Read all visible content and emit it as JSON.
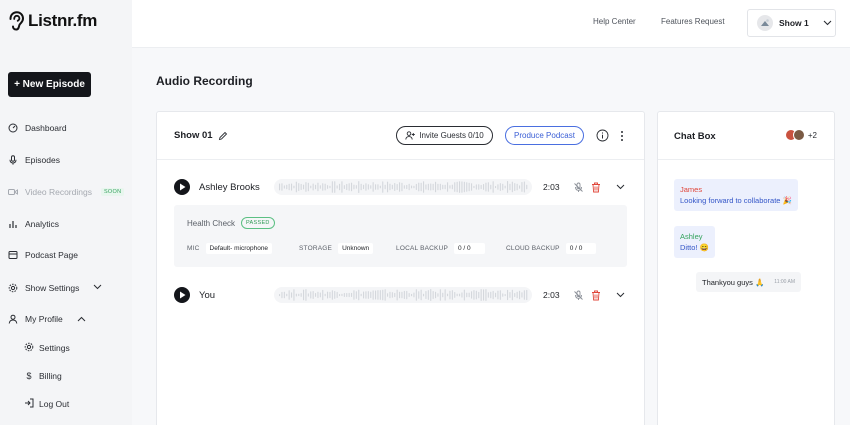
{
  "app": {
    "brand": "Listnr.fm",
    "new_episode_label": "+ New Episode"
  },
  "sidebar": {
    "items": [
      {
        "label": "Dashboard",
        "icon": "dashboard-icon"
      },
      {
        "label": "Episodes",
        "icon": "mic-icon"
      },
      {
        "label": "Video Recordings",
        "icon": "video-icon",
        "badge": "SOON",
        "disabled": true
      },
      {
        "label": "Analytics",
        "icon": "bar-chart-icon"
      },
      {
        "label": "Podcast Page",
        "icon": "page-icon"
      },
      {
        "label": "Show Settings",
        "icon": "gear-icon",
        "expandable": true
      },
      {
        "label": "My Profile",
        "icon": "user-icon",
        "expanded": true
      }
    ],
    "profile_sub": [
      {
        "label": "Settings",
        "icon": "gear-icon"
      },
      {
        "label": "Billing",
        "icon": "dollar-icon"
      },
      {
        "label": "Log Out",
        "icon": "logout-icon"
      }
    ]
  },
  "topbar": {
    "help": "Help Center",
    "features": "Features Request",
    "show_selector": "Show 1"
  },
  "main": {
    "title": "Audio Recording",
    "show_name": "Show 01",
    "invite_label": "Invite Guests 0/10",
    "produce_label": "Produce Podcast",
    "tracks": [
      {
        "name": "Ashley Brooks",
        "duration": "2:03"
      },
      {
        "name": "You",
        "duration": "2:03"
      }
    ],
    "health": {
      "title": "Health Check",
      "status": "PASSED",
      "fields": [
        {
          "label": "MIC",
          "value": "Default- microphone"
        },
        {
          "label": "STORAGE",
          "value": "Unknown"
        },
        {
          "label": "LOCAL BACKUP",
          "value": "0 / 0"
        },
        {
          "label": "CLOUD BACKUP",
          "value": "0 / 0"
        }
      ]
    }
  },
  "chat": {
    "title": "Chat Box",
    "extra_participants": "+2",
    "messages": [
      {
        "name": "James",
        "name_color": "#e0463a",
        "text": "Looking forward to collaborate 🎉"
      },
      {
        "name": "Ashley",
        "name_color": "#35a35e",
        "text": "Ditto! 😄"
      },
      {
        "text": "Thankyou guys 🙏",
        "time": "11:00 AM",
        "own": true
      }
    ]
  },
  "colors": {
    "accent": "#3b5fd6",
    "dark": "#14161b",
    "delete": "#e0463a"
  }
}
